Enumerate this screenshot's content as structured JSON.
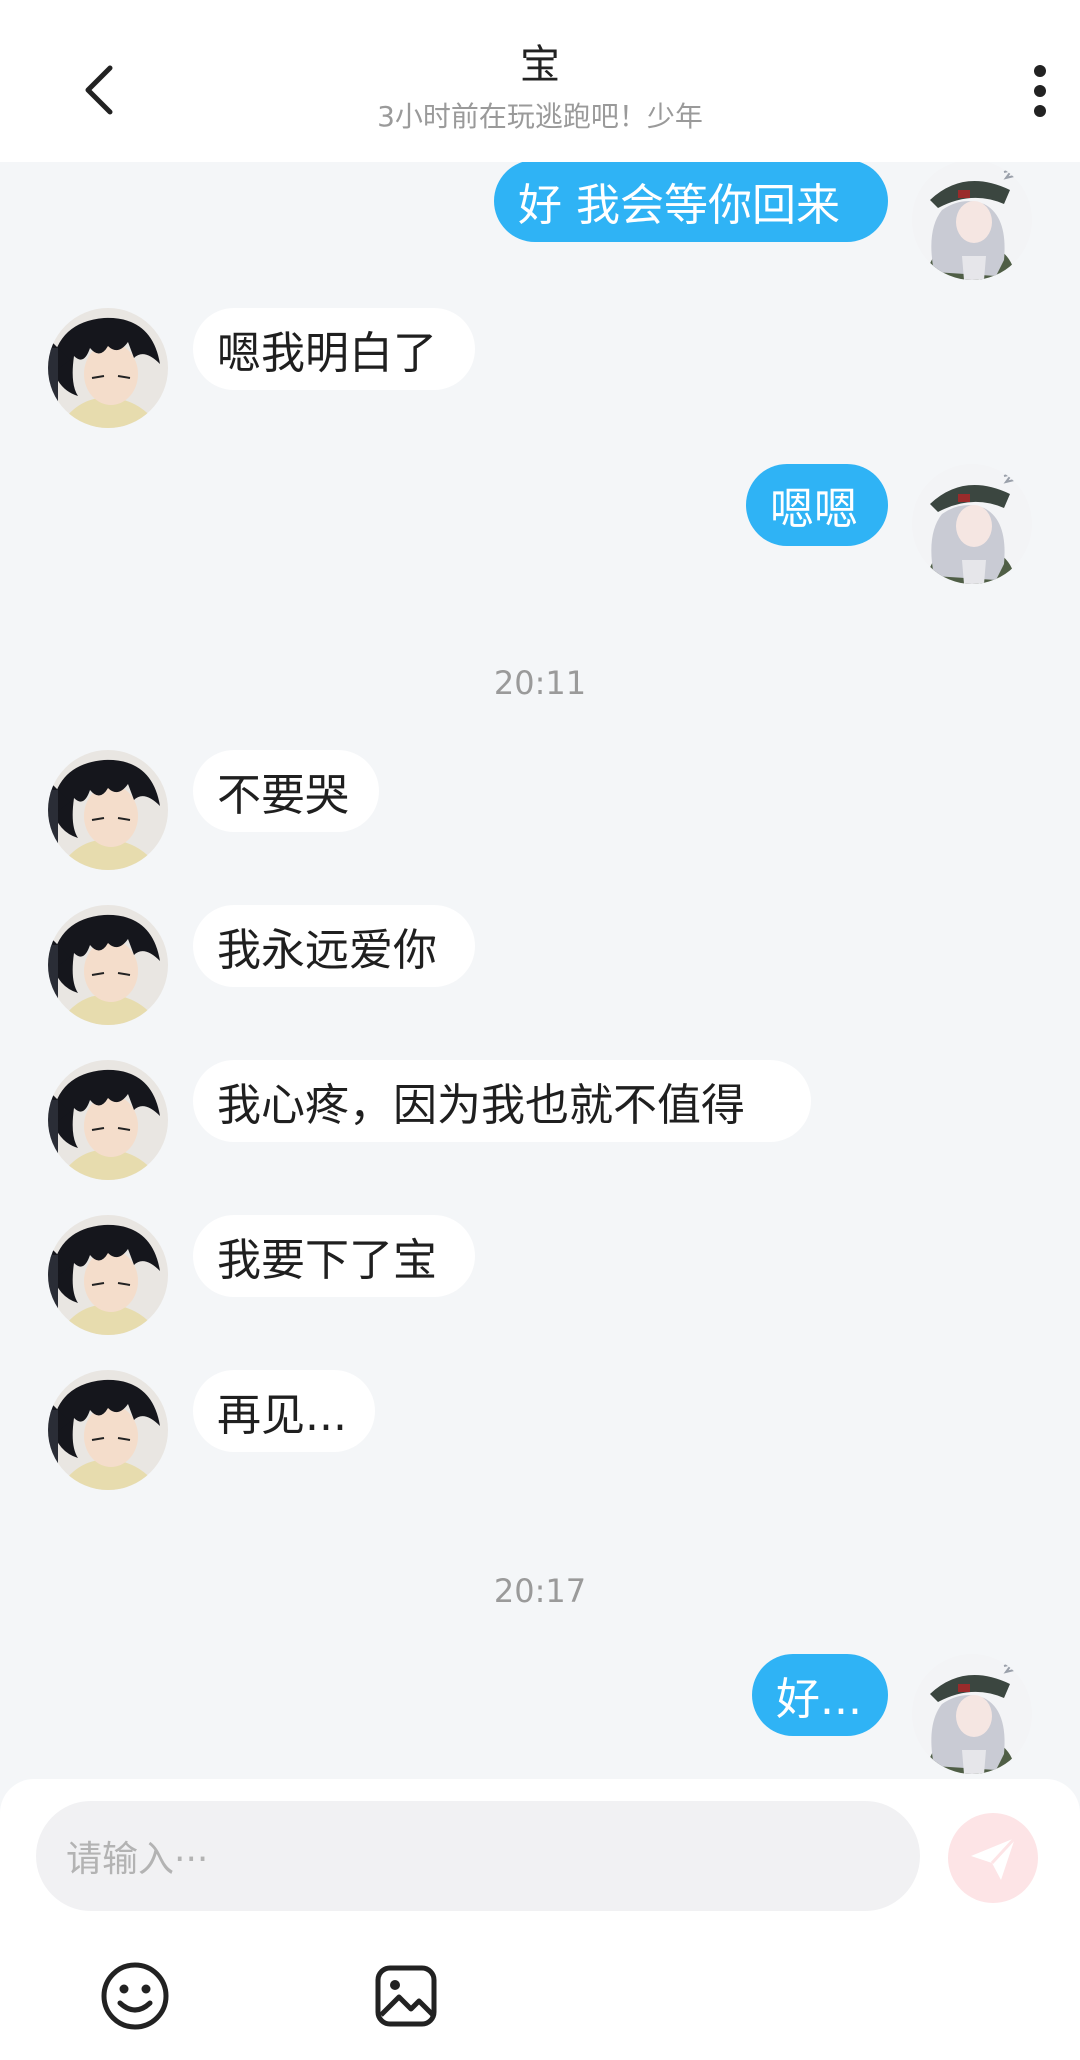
{
  "header": {
    "title": "宝",
    "subtitle": "3小时前在玩逃跑吧！少年",
    "back_icon": "chevron-left-icon",
    "more_icon": "more-vertical-icon"
  },
  "messages": [
    {
      "from": "me",
      "text": "好 我会等你回来"
    },
    {
      "from": "them",
      "text": "嗯我明白了"
    },
    {
      "from": "me",
      "text": "嗯嗯"
    },
    {
      "timestamp": "20:11"
    },
    {
      "from": "them",
      "text": "不要哭"
    },
    {
      "from": "them",
      "text": "我永远爱你"
    },
    {
      "from": "them",
      "text": "我心疼，因为我也就不值得"
    },
    {
      "from": "them",
      "text": "我要下了宝"
    },
    {
      "from": "them",
      "text": "再见..."
    },
    {
      "timestamp": "20:17"
    },
    {
      "from": "me",
      "text": "好..."
    }
  ],
  "composer": {
    "placeholder": "请输入···",
    "send_icon": "send-paper-plane-icon",
    "emoji_icon": "smiley-face-icon",
    "image_icon": "image-picture-icon"
  },
  "colors": {
    "outgoing_bubble": "#2fb3f5",
    "incoming_bubble": "#ffffff",
    "background": "#f4f6f8",
    "send_button_disabled": "#fde4e6"
  }
}
